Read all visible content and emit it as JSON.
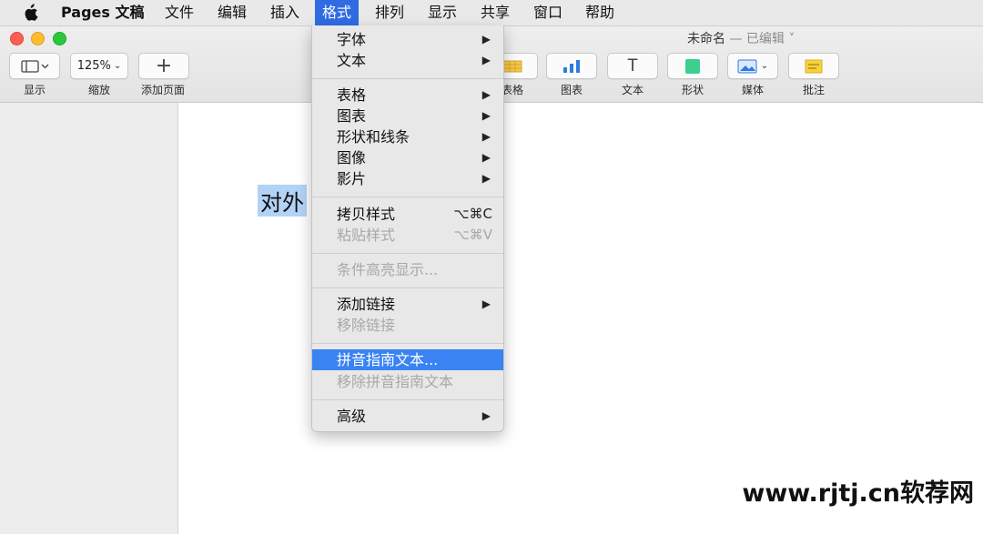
{
  "menubar": {
    "items": [
      "Pages 文稿",
      "文件",
      "编辑",
      "插入",
      "格式",
      "排列",
      "显示",
      "共享",
      "窗口",
      "帮助"
    ],
    "active": "格式"
  },
  "window": {
    "title": "未命名",
    "status": "— 已编辑 ˅"
  },
  "toolbar": {
    "view_label": "显示",
    "zoom_value": "125%",
    "zoom_label": "缩放",
    "add_page_label": "添加页面",
    "table_label": "表格",
    "chart_label": "图表",
    "text_label": "文本",
    "shape_label": "形状",
    "media_label": "媒体",
    "comment_label": "批注"
  },
  "document": {
    "selected_text": "对外"
  },
  "format_menu": {
    "font": "字体",
    "text": "文本",
    "table": "表格",
    "chart": "图表",
    "shapes_lines": "形状和线条",
    "image": "图像",
    "movie": "影片",
    "copy_style": "拷贝样式",
    "copy_style_shortcut": "⌥⌘C",
    "paste_style": "粘贴样式",
    "paste_style_shortcut": "⌥⌘V",
    "conditional_highlight": "条件高亮显示...",
    "add_link": "添加链接",
    "remove_link": "移除链接",
    "pinyin_guide": "拼音指南文本...",
    "remove_pinyin": "移除拼音指南文本",
    "advanced": "高级"
  },
  "watermark": "www.rjtj.cn软荐网",
  "colors": {
    "menu_highlight": "#3a83f2",
    "menubar_active": "#2f6be3",
    "selection": "#b3d3f6"
  }
}
